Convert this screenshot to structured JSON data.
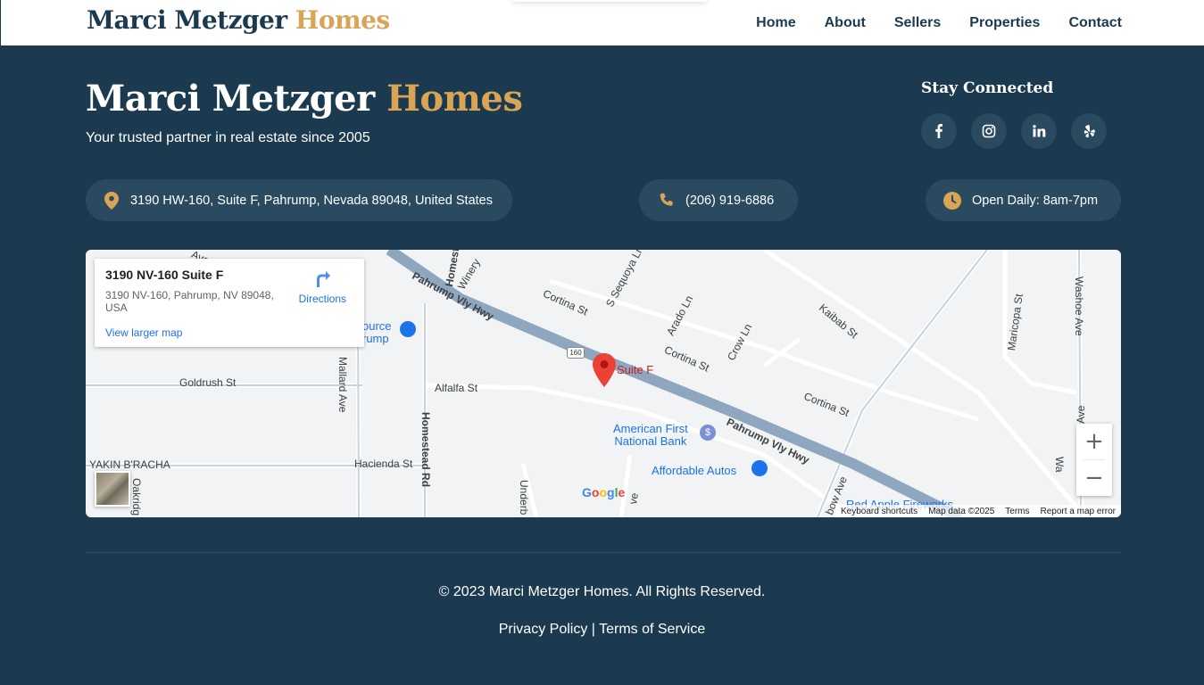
{
  "header": {
    "brand_name": "Marci Metzger",
    "brand_accent": "Homes",
    "nav": [
      "Home",
      "About",
      "Sellers",
      "Properties",
      "Contact"
    ]
  },
  "hero": {
    "title_main": "Marci Metzger",
    "title_accent": "Homes",
    "tagline": "Your trusted partner in real estate since 2005"
  },
  "social": {
    "title": "Stay Connected",
    "icons": [
      "facebook-icon",
      "instagram-icon",
      "linkedin-icon",
      "yelp-icon"
    ]
  },
  "contact": {
    "address": "3190 HW-160, Suite F, Pahrump, Nevada 89048, United States",
    "phone": "(206) 919-6886",
    "hours": "Open Daily: 8am-7pm"
  },
  "map": {
    "place_name": "3190 NV-160 Suite F",
    "place_address": "3190 NV-160, Pahrump, NV 89048, USA",
    "directions_label": "Directions",
    "larger_map_label": "View larger map",
    "pin_label": "Suite F",
    "route_shield": "160",
    "streets": {
      "winery": "Winery",
      "pahrump_vly_hwy_1": "Pahrump Vly Hwy",
      "pahrump_vly_hwy_2": "Pahrump Vly Hwy",
      "homestead_rd_1": "Homestead Rd",
      "homestead_rd_2": "Homestead Rd",
      "mallard_ave": "Mallard Ave",
      "goldrush_st": "Goldrush St",
      "alfalfa_st": "Alfalfa St",
      "hacienda_st": "Hacienda St",
      "cortina_st_1": "Cortina St",
      "cortina_st_2": "Cortina St",
      "cortina_st_3": "Cortina St",
      "sequoya": "S Sequoya Ln",
      "arado_ln": "Arado Ln",
      "crow_ln": "Crow Ln",
      "kaibab_st": "Kaibab St",
      "maricopa_st": "Maricopa St",
      "washoe_ave": "Washoe Ave",
      "oakridge": "Oakridg",
      "yakin": "YAKIN B'RACHA",
      "ave_top": "Ave",
      "source_a": "ource",
      "source_b": "rump",
      "underb": "Underb",
      "ve_bottom": "ve",
      "bow_ave": "bow Ave",
      "ave_right": "Ave",
      "w_right": "Wa",
      "red_apple": "Red Apple Fireworks"
    },
    "pois": {
      "bank_line1": "American First",
      "bank_line2": "National Bank",
      "autos": "Affordable Autos"
    },
    "google": "Google",
    "attribution": [
      "Keyboard shortcuts",
      "Map data ©2025",
      "Terms",
      "Report a map error"
    ]
  },
  "footer": {
    "copyright": "© 2023 Marci Metzger Homes. All Rights Reserved.",
    "privacy": "Privacy Policy",
    "separator": "|",
    "terms": "Terms of Service"
  },
  "colors": {
    "navy": "#1b3a4f",
    "gold": "#d9a456",
    "pill": "#2a4a60"
  }
}
